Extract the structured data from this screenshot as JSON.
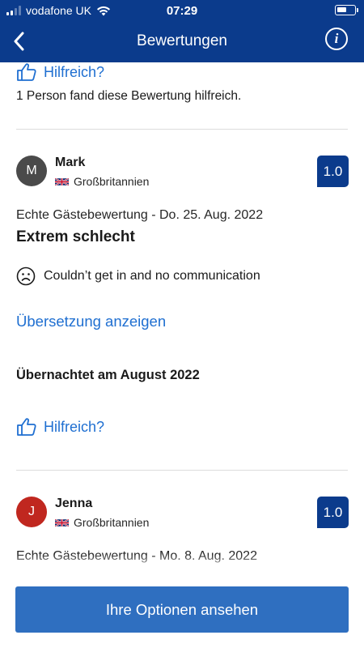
{
  "status_bar": {
    "carrier": "vodafone UK",
    "time": "07:29",
    "battery_level": 0.6
  },
  "header": {
    "title": "Bewertungen",
    "back_icon": "chevron-left-icon",
    "info_icon": "info-icon",
    "info_glyph": "i"
  },
  "previous_review_tail": {
    "helpful_label": "Hilfreich?",
    "helpful_count_text": "1 Person fand diese Bewertung hilfreich."
  },
  "reviews": [
    {
      "initial": "M",
      "avatar_color": "#4a4a4a",
      "name": "Mark",
      "country": "Großbritannien",
      "score": "1.0",
      "date": "Echte Gästebewertung - Do. 25. Aug. 2022",
      "title": "Extrem schlecht",
      "comment": "Couldn’t get in and no communication",
      "translate_label": "Übersetzung anzeigen",
      "stayed": "Übernachtet am August 2022",
      "helpful_label": "Hilfreich?"
    },
    {
      "initial": "J",
      "avatar_color": "#c0271f",
      "name": "Jenna",
      "country": "Großbritannien",
      "score": "1.0",
      "date": "Echte Gästebewertung - Mo. 8. Aug. 2022"
    }
  ],
  "cta": {
    "label": "Ihre Optionen ansehen"
  },
  "colors": {
    "brand_blue": "#0b3b8c",
    "link_blue": "#1f6fd1",
    "button_blue": "#2f6fc0"
  }
}
